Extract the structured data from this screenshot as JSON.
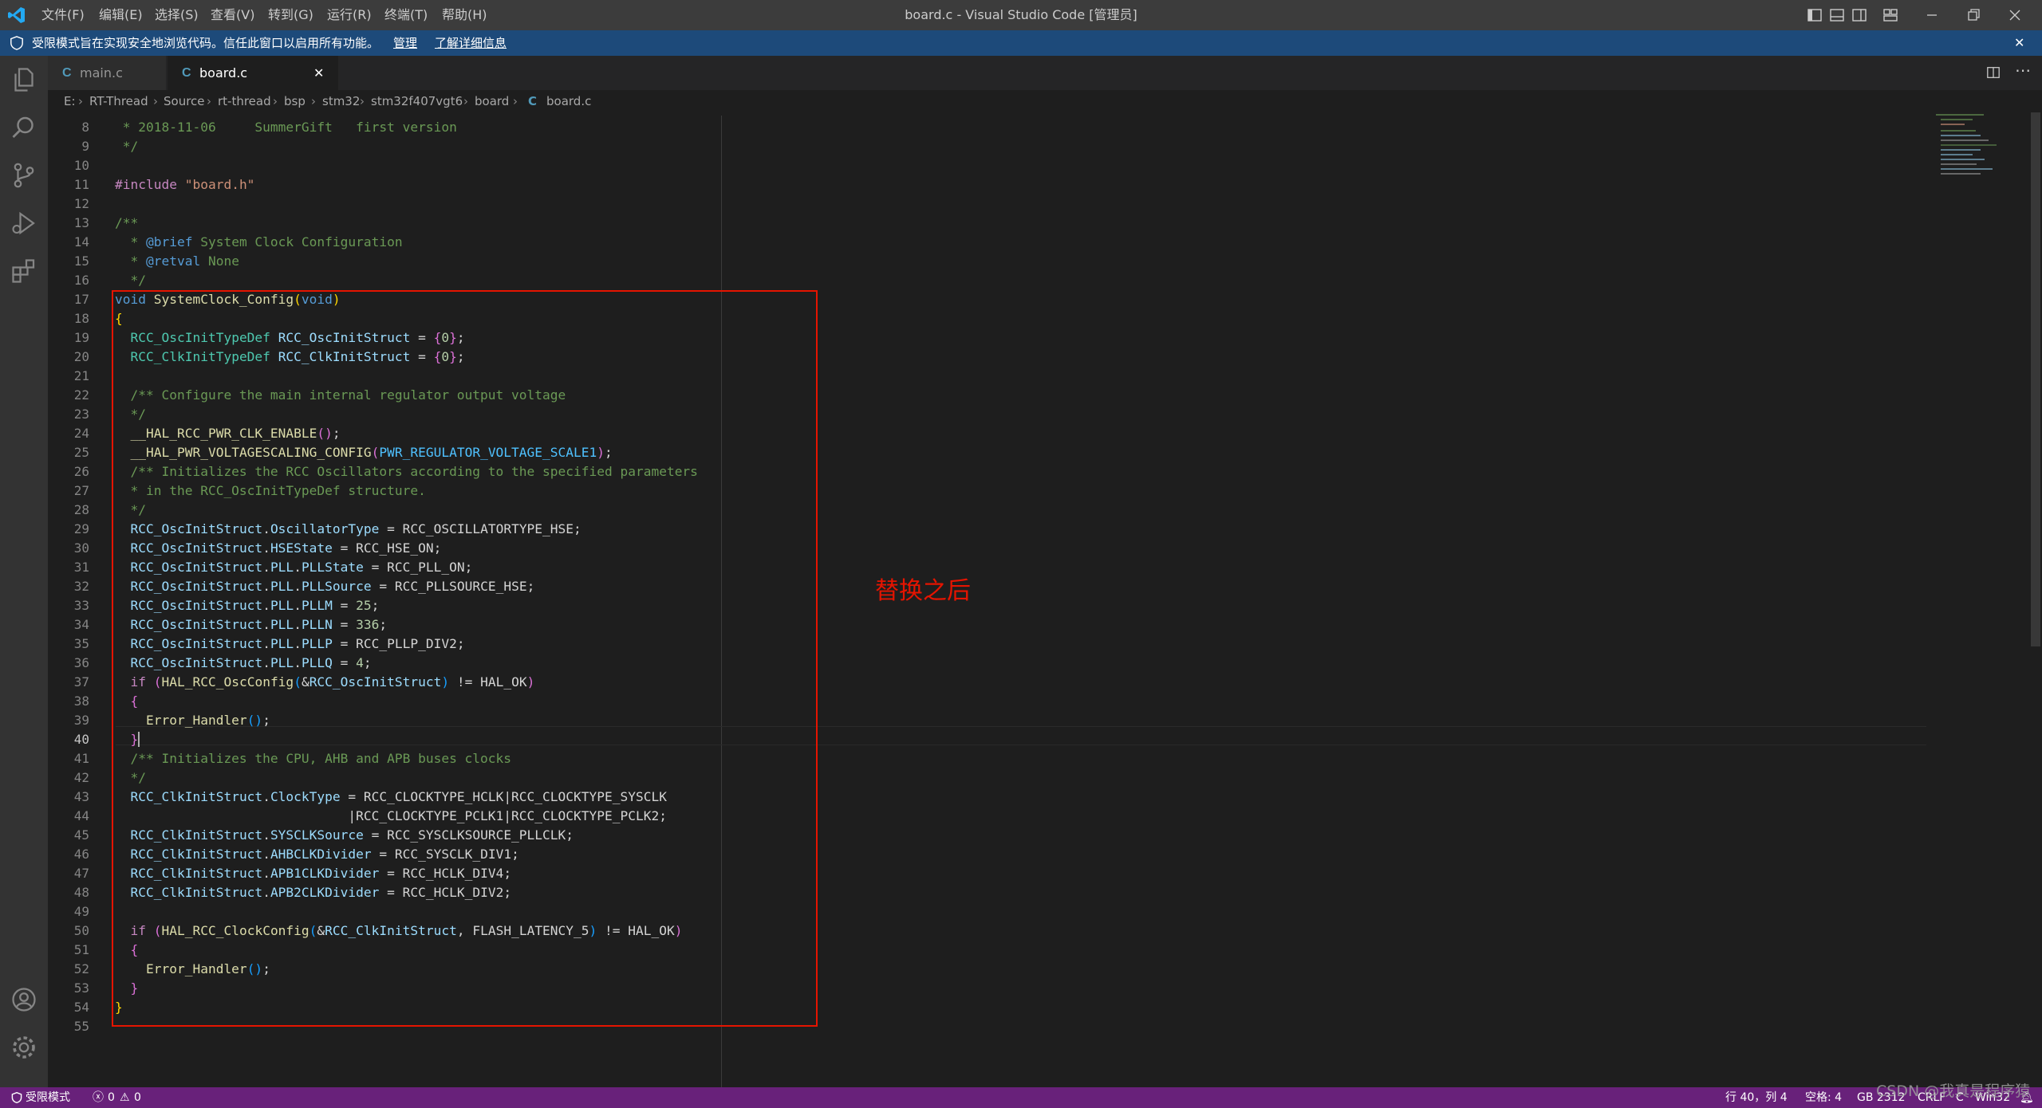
{
  "window": {
    "title": "board.c - Visual Studio Code [管理员]",
    "menu": [
      "文件(F)",
      "编辑(E)",
      "选择(S)",
      "查看(V)",
      "转到(G)",
      "运行(R)",
      "终端(T)",
      "帮助(H)"
    ]
  },
  "banner": {
    "message": "受限模式旨在实现安全地浏览代码。信任此窗口以启用所有功能。",
    "manage": "管理",
    "learn_more": "了解详细信息",
    "close": "✕"
  },
  "tabs": [
    {
      "icon": "C",
      "label": "main.c"
    },
    {
      "icon": "C",
      "label": "board.c",
      "close": "✕"
    }
  ],
  "breadcrumb": [
    "E:",
    "RT-Thread",
    "Source",
    "rt-thread",
    "bsp",
    "stm32",
    "stm32f407vgt6",
    "board",
    "board.c"
  ],
  "editor": {
    "active_line": 40,
    "line_numbers": [
      "8",
      "9",
      "10",
      "11",
      "12",
      "13",
      "14",
      "15",
      "16",
      "17",
      "18",
      "19",
      "20",
      "21",
      "22",
      "23",
      "24",
      "25",
      "26",
      "27",
      "28",
      "29",
      "30",
      "31",
      "32",
      "33",
      "34",
      "35",
      "36",
      "37",
      "38",
      "39",
      "40",
      "41",
      "42",
      "43",
      "44",
      "45",
      "46",
      "47",
      "48",
      "49",
      "50",
      "51",
      "52",
      "53",
      "54",
      "55"
    ],
    "annotation": "替换之后"
  },
  "statusbar": {
    "restricted_mode": "受限模式",
    "errors": "0",
    "warnings": "0",
    "position": "行 40，列 4",
    "spaces": "空格: 4",
    "encoding": "GB 2312",
    "eol": "CRLF",
    "language": "C",
    "platform": "Win32"
  },
  "watermark": "CSDN @我真是程序猿",
  "colors": {
    "titlebar": "#3c3c3c",
    "banner": "#1d4a7a",
    "activitybar": "#333333",
    "editor": "#1e1e1e",
    "statusbar": "#68217a",
    "annotation": "#e51400"
  }
}
